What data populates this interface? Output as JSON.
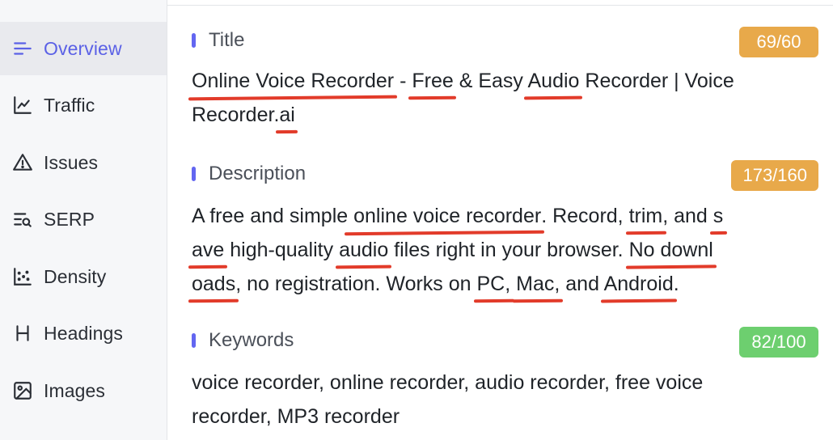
{
  "sidebar": {
    "items": [
      {
        "label": "Overview",
        "icon": "overview-icon",
        "active": true
      },
      {
        "label": "Traffic",
        "icon": "traffic-chart-icon",
        "active": false
      },
      {
        "label": "Issues",
        "icon": "warning-triangle-icon",
        "active": false
      },
      {
        "label": "SERP",
        "icon": "serp-search-icon",
        "active": false
      },
      {
        "label": "Density",
        "icon": "density-scatter-icon",
        "active": false
      },
      {
        "label": "Headings",
        "icon": "heading-h-icon",
        "active": false
      },
      {
        "label": "Images",
        "icon": "image-icon",
        "active": false
      }
    ]
  },
  "colors": {
    "accent": "#5b61e6",
    "badge_warning": "#e8a94a",
    "badge_ok": "#6dcf6f",
    "annotation_underline": "#e23b2a"
  },
  "title_section": {
    "label": "Title",
    "badge": "69/60",
    "lines": [
      [
        "Online Voice Recorder",
        " - ",
        "Free",
        " & Easy ",
        "Audio",
        " Recorder | Voice"
      ],
      [
        "Recorder.",
        "ai"
      ]
    ]
  },
  "description_section": {
    "label": "Description",
    "badge": "173/160",
    "lines": [
      [
        "A free and simple",
        " online voice recorder",
        ". Record, ",
        "trim",
        ", and ",
        "s"
      ],
      [
        "ave",
        " high-quality ",
        "audio",
        " files right in your browser. ",
        "No downl"
      ],
      [
        "oads",
        ", no registration. Works on ",
        "PC,",
        " ",
        "Mac,",
        " and ",
        "Android",
        "."
      ]
    ]
  },
  "keywords_section": {
    "label": "Keywords",
    "badge": "82/100",
    "lines": [
      "voice recorder, online recorder, audio recorder, free voice",
      "recorder, MP3 recorder"
    ]
  }
}
